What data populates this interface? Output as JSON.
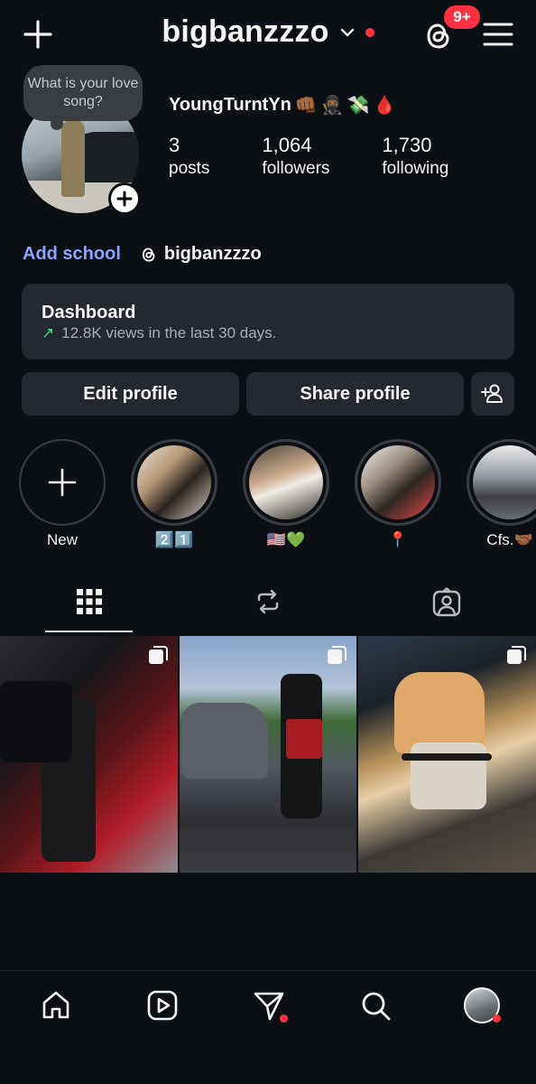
{
  "header": {
    "username": "bigbanzzzo",
    "notification_badge": "9+"
  },
  "profile": {
    "note": "What is your love song?",
    "display_name": "YoungTurntYn",
    "name_emojis": [
      "👊🏾",
      "🥷🏾",
      "💸",
      "🩸"
    ],
    "stats": [
      {
        "value": "3",
        "label": "posts"
      },
      {
        "value": "1,064",
        "label": "followers"
      },
      {
        "value": "1,730",
        "label": "following"
      }
    ],
    "add_school": "Add school",
    "threads_handle": "bigbanzzzo"
  },
  "dashboard": {
    "title": "Dashboard",
    "arrow": "↗",
    "subtitle": "12.8K views in the last 30 days."
  },
  "actions": {
    "edit_profile": "Edit profile",
    "share_profile": "Share profile"
  },
  "highlights": [
    {
      "label": "New"
    },
    {
      "label": "2️⃣1️⃣"
    },
    {
      "label": "🇺🇸💚"
    },
    {
      "label": "📍"
    },
    {
      "label": "Cfs.🤝🏾"
    }
  ],
  "tabs": [
    "grid-icon",
    "reels-icon",
    "tagged-icon"
  ],
  "posts": [
    {
      "type": "carousel"
    },
    {
      "type": "carousel"
    },
    {
      "type": "carousel"
    }
  ],
  "colors": {
    "background": "#0c0f14",
    "card": "#25292f",
    "accent_link": "#8ba2ff",
    "badge_red": "#ff3040",
    "trend_green": "#3ddc84"
  },
  "bottom_nav": [
    "home-icon",
    "reels-icon",
    "direct-icon",
    "search-icon",
    "profile-avatar"
  ]
}
